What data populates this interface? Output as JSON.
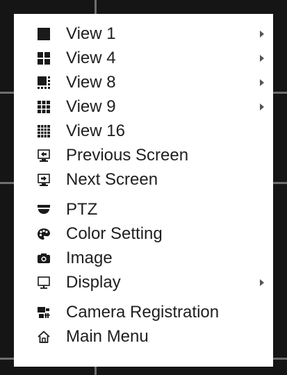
{
  "menu": {
    "items": [
      {
        "label": "View 1",
        "icon": "view1-icon",
        "submenu": true
      },
      {
        "label": "View 4",
        "icon": "view4-icon",
        "submenu": true
      },
      {
        "label": "View 8",
        "icon": "view8-icon",
        "submenu": true
      },
      {
        "label": "View 9",
        "icon": "view9-icon",
        "submenu": true
      },
      {
        "label": "View 16",
        "icon": "view16-icon",
        "submenu": false
      },
      {
        "label": "Previous Screen",
        "icon": "previous-screen-icon",
        "submenu": false
      },
      {
        "label": "Next Screen",
        "icon": "next-screen-icon",
        "submenu": false
      },
      {
        "label": "PTZ",
        "icon": "ptz-camera-icon",
        "submenu": false
      },
      {
        "label": "Color Setting",
        "icon": "palette-icon",
        "submenu": false
      },
      {
        "label": "Image",
        "icon": "camera-icon",
        "submenu": false
      },
      {
        "label": "Display",
        "icon": "monitor-icon",
        "submenu": true
      },
      {
        "label": "Camera Registration",
        "icon": "camera-registration-icon",
        "submenu": false
      },
      {
        "label": "Main Menu",
        "icon": "home-icon",
        "submenu": false
      }
    ]
  },
  "colors": {
    "menu_background": "#ffffff",
    "text": "#202020",
    "icon": "#1a1a1a",
    "backdrop": "#151515"
  }
}
